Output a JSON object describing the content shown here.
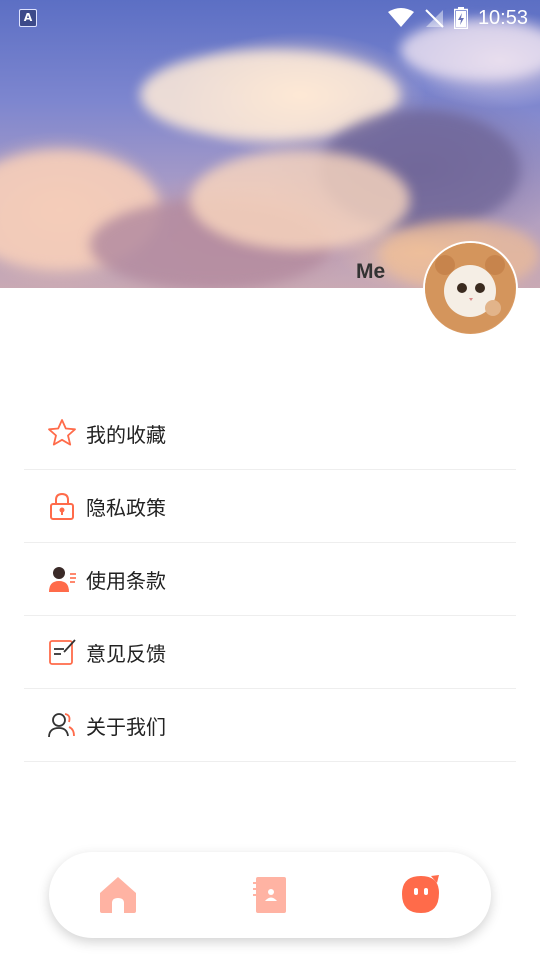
{
  "status_bar": {
    "time": "10:53",
    "app_icon_letter": "A"
  },
  "profile": {
    "name": "Me"
  },
  "menu": {
    "items": [
      {
        "label": "我的收藏",
        "icon": "star-icon"
      },
      {
        "label": "隐私政策",
        "icon": "lock-icon"
      },
      {
        "label": "使用条款",
        "icon": "user-terms-icon"
      },
      {
        "label": "意见反馈",
        "icon": "feedback-edit-icon"
      },
      {
        "label": "关于我们",
        "icon": "users-icon"
      }
    ]
  },
  "tab_bar": {
    "tabs": [
      {
        "icon": "home-icon",
        "active": false
      },
      {
        "icon": "contacts-book-icon",
        "active": false
      },
      {
        "icon": "me-face-icon",
        "active": true
      }
    ]
  },
  "colors": {
    "accent": "#ff6b4a",
    "accent_light": "#ffb3a3",
    "text": "#222222",
    "divider": "#eeeeee"
  }
}
